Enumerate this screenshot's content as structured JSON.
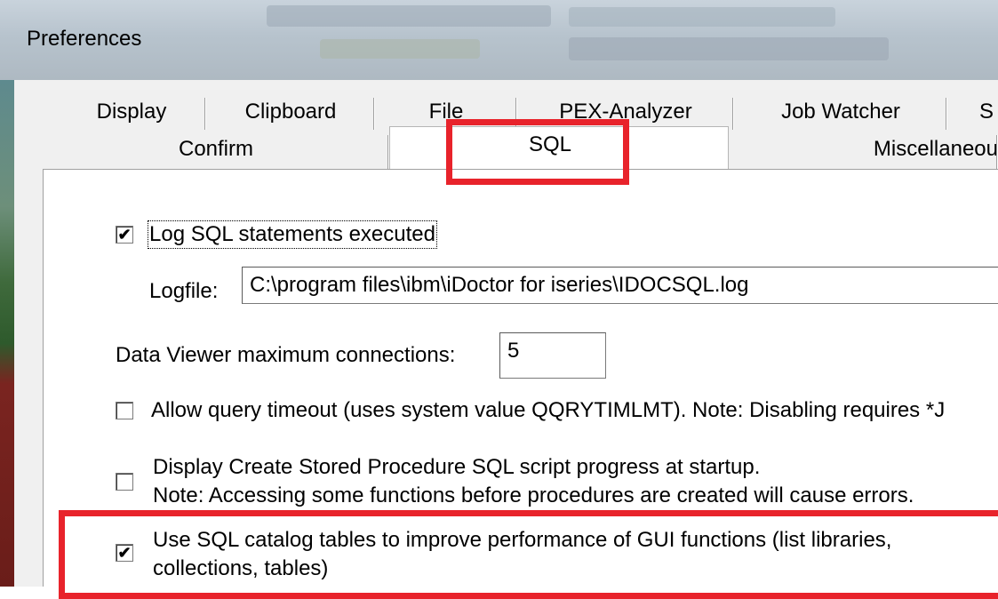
{
  "window": {
    "title": "Preferences"
  },
  "tabs": {
    "row1": [
      "Display",
      "Clipboard",
      "File",
      "PEX-Analyzer",
      "Job Watcher",
      "S"
    ],
    "row2": [
      "Confirm",
      "SQL",
      "Miscellaneous"
    ],
    "active": "SQL"
  },
  "sql": {
    "log_sql_label": "Log SQL statements executed",
    "log_sql_checked": true,
    "logfile_label": "Logfile:",
    "logfile_value": "C:\\program files\\ibm\\iDoctor for iseries\\IDOCSQL.log",
    "max_conn_label": "Data Viewer maximum connections:",
    "max_conn_value": "5",
    "query_timeout_label": "Allow query timeout (uses system value QQRYTIMLMT). Note: Disabling requires *J",
    "query_timeout_checked": false,
    "create_proc_line1": "Display Create Stored Procedure SQL script progress at startup.",
    "create_proc_line2": "Note: Accessing some functions before procedures are created will cause errors.",
    "create_proc_checked": false,
    "catalog_line1": "Use SQL catalog tables to improve performance of GUI functions (list libraries,",
    "catalog_line2": "collections, tables)",
    "catalog_checked": true
  },
  "check_glyph": "✔",
  "colors": {
    "highlight": "#e8232b",
    "dialog_bg": "#f0f0f0"
  }
}
